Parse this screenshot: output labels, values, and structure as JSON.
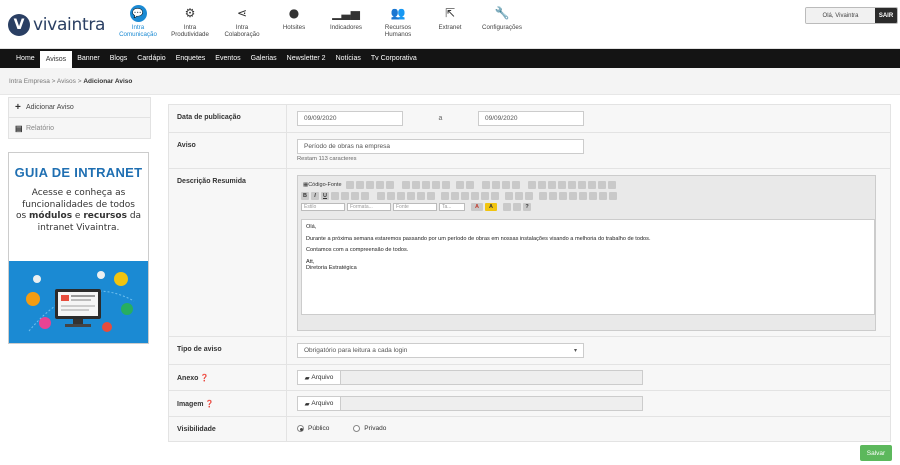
{
  "brand": {
    "logo_letter": "V",
    "logo_text": "vivaintra",
    "brand_color": "#2a3f63"
  },
  "modules": [
    {
      "label1": "Intra",
      "label2": "Comunicação",
      "icon": "chat-bubble-icon",
      "active": true
    },
    {
      "label1": "Intra",
      "label2": "Produtividade",
      "icon": "gears-icon",
      "active": false
    },
    {
      "label1": "Intra",
      "label2": "Colaboração",
      "icon": "share-icon",
      "active": false
    },
    {
      "label1": "Hotsites",
      "label2": "",
      "icon": "globe-icon",
      "active": false
    },
    {
      "label1": "Indicadores",
      "label2": "",
      "icon": "bar-signal-icon",
      "active": false
    },
    {
      "label1": "Recursos",
      "label2": "Humanos",
      "icon": "people-icon",
      "active": false
    },
    {
      "label1": "Extranet",
      "label2": "",
      "icon": "external-link-icon",
      "active": false
    },
    {
      "label1": "Configurações",
      "label2": "",
      "icon": "wrench-icon",
      "active": false
    }
  ],
  "user": {
    "name": "Olá, Vivaintra",
    "logout": "SAIR"
  },
  "nav": [
    {
      "label": "Home"
    },
    {
      "label": "Avisos",
      "active": true
    },
    {
      "label": "Banner"
    },
    {
      "label": "Blogs"
    },
    {
      "label": "Cardápio"
    },
    {
      "label": "Enquetes"
    },
    {
      "label": "Eventos"
    },
    {
      "label": "Galerias"
    },
    {
      "label": "Newsletter 2"
    },
    {
      "label": "Notícias"
    },
    {
      "label": "Tv Corporativa"
    }
  ],
  "breadcrumb": {
    "a": "Intra Empresa",
    "b": "Avisos",
    "current": "Adicionar Aviso",
    "sep": ">"
  },
  "sidebar": {
    "add": "Adicionar Aviso",
    "report": "Relatório"
  },
  "banner": {
    "title": "GUIA DE INTRANET",
    "line1": "Acesse e conheça as",
    "line2": "funcionalidades de todos",
    "line3a": "os ",
    "line3b": "módulos",
    "line3c": " e ",
    "line3d": "recursos",
    "line3e": " da",
    "line4": "intranet Vivaintra."
  },
  "form": {
    "pub_label": "Data de publicação",
    "date_start": "09/09/2020",
    "date_sep": "a",
    "date_end": "09/09/2020",
    "aviso_label": "Aviso",
    "aviso_value": "Período de obras na empresa",
    "aviso_hint": "Restam 113 caracteres",
    "desc_label": "Descrição Resumida",
    "toolbar_source": "Código-Fonte",
    "toolbar_bold": "B",
    "toolbar_italic": "I",
    "toolbar_underline": "U",
    "style_select": "Estilo",
    "format_select": "Formata...",
    "font_select": "Fonte",
    "size_select": "Ta...",
    "content_p1": "Olá,",
    "content_p2": "Durante a próxima semana estaremos passando por um período de obras em nossas instalações visando a melhoria do trabalho de todos.",
    "content_p3": "Contamos com a compreensão de todos.",
    "content_p4a": "Att,",
    "content_p4b": "Diretoria Estratégica",
    "tipo_label": "Tipo de aviso",
    "tipo_value": "Obrigatório para leitura a cada login",
    "anexo_label": "Anexo",
    "imagem_label": "Imagem",
    "file_button": "Arquivo",
    "visib_label": "Visibilidade",
    "opt_public": "Público",
    "opt_private": "Privado"
  },
  "save": "Salvar"
}
